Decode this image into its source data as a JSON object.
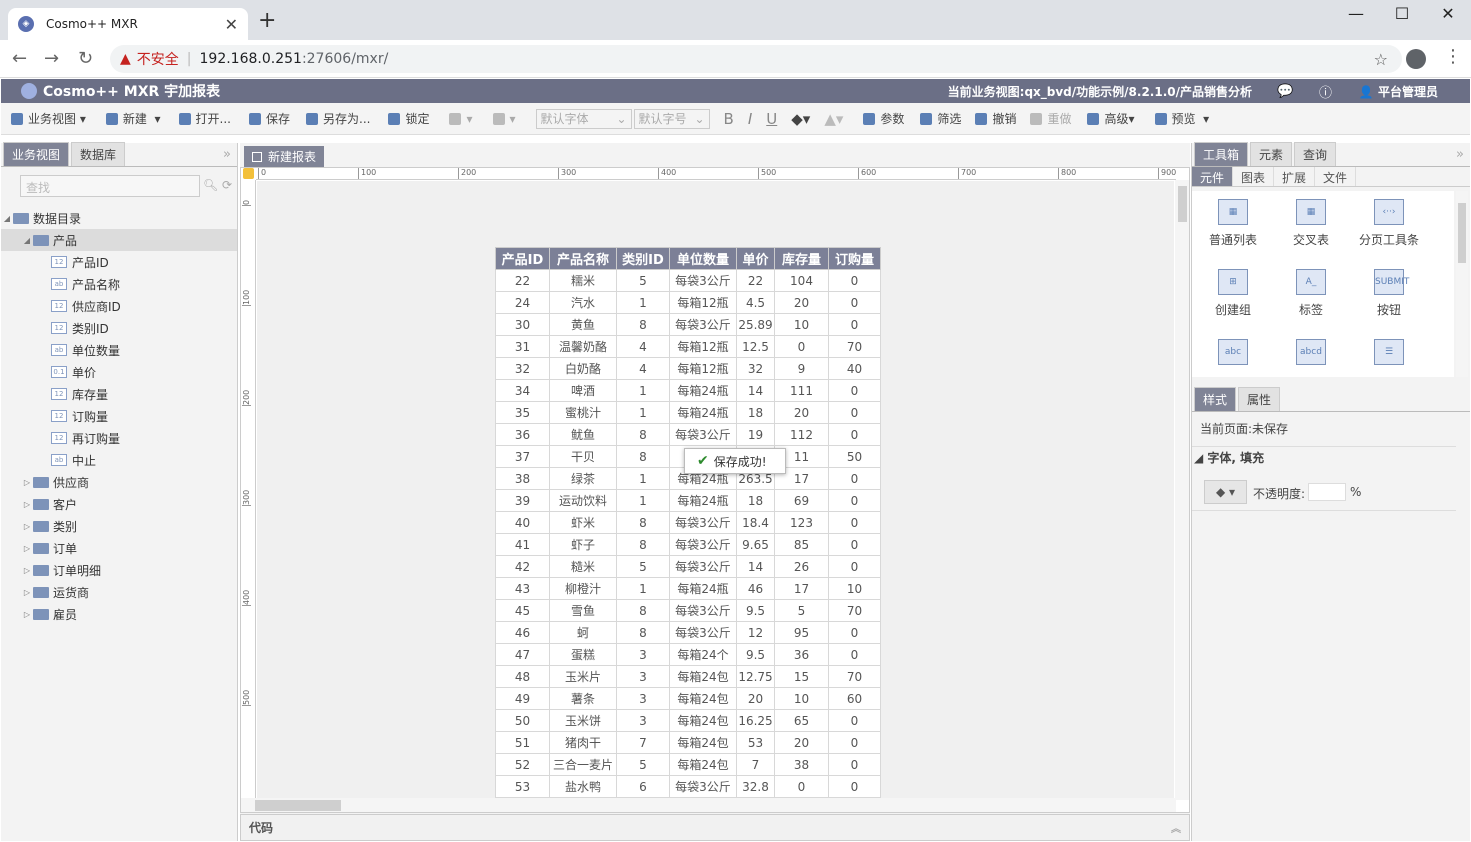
{
  "browser": {
    "tab_title": "Cosmo++ MXR",
    "insecure_label": "不安全",
    "url_host": "192.168.0.251",
    "url_rest": ":27606/mxr/"
  },
  "app": {
    "name": "Cosmo++ MXR 宇加报表",
    "business_view": "当前业务视图:qx_bvd/功能示例/8.2.1.0/产品销售分析",
    "user": "平台管理员"
  },
  "toolbar": {
    "business_view": "业务视图",
    "new": "新建",
    "open": "打开...",
    "save": "保存",
    "save_as": "另存为...",
    "lock": "锁定",
    "font_default": "默认字体",
    "size_default": "默认字号",
    "bold": "B",
    "italic": "I",
    "underline": "U",
    "params": "参数",
    "filter": "筛选",
    "undo": "撤销",
    "redo": "重做",
    "advanced": "高级",
    "preview": "预览"
  },
  "left_panel": {
    "tabs": [
      "业务视图",
      "数据库"
    ],
    "search_placeholder": "查找",
    "tree": {
      "root": "数据目录",
      "expanded": "产品",
      "fields": [
        {
          "type": "12",
          "label": "产品ID"
        },
        {
          "type": "ab",
          "label": "产品名称"
        },
        {
          "type": "12",
          "label": "供应商ID"
        },
        {
          "type": "12",
          "label": "类别ID"
        },
        {
          "type": "ab",
          "label": "单位数量"
        },
        {
          "type": "0.1",
          "label": "单价"
        },
        {
          "type": "12",
          "label": "库存量"
        },
        {
          "type": "12",
          "label": "订购量"
        },
        {
          "type": "12",
          "label": "再订购量"
        },
        {
          "type": "ab",
          "label": "中止"
        }
      ],
      "collapsed": [
        "供应商",
        "客户",
        "类别",
        "订单",
        "订单明细",
        "运货商",
        "雇员"
      ]
    }
  },
  "editor": {
    "doc_tab": "新建报表",
    "ruler_h": [
      "0",
      "100",
      "200",
      "300",
      "400",
      "500",
      "600",
      "700",
      "800",
      "900"
    ],
    "ruler_v": [
      "0",
      "100",
      "200",
      "300",
      "400",
      "500"
    ],
    "columns": [
      "产品ID",
      "产品名称",
      "类别ID",
      "单位数量",
      "单价",
      "库存量",
      "订购量"
    ],
    "rows": [
      [
        "22",
        "糯米",
        "5",
        "每袋3公斤",
        "22",
        "104",
        "0"
      ],
      [
        "24",
        "汽水",
        "1",
        "每箱12瓶",
        "4.5",
        "20",
        "0"
      ],
      [
        "30",
        "黄鱼",
        "8",
        "每袋3公斤",
        "25.89",
        "10",
        "0"
      ],
      [
        "31",
        "温馨奶酪",
        "4",
        "每箱12瓶",
        "12.5",
        "0",
        "70"
      ],
      [
        "32",
        "白奶酪",
        "4",
        "每箱12瓶",
        "32",
        "9",
        "40"
      ],
      [
        "34",
        "啤酒",
        "1",
        "每箱24瓶",
        "14",
        "111",
        "0"
      ],
      [
        "35",
        "蜜桃汁",
        "1",
        "每箱24瓶",
        "18",
        "20",
        "0"
      ],
      [
        "36",
        "鱿鱼",
        "8",
        "每袋3公斤",
        "19",
        "112",
        "0"
      ],
      [
        "37",
        "干贝",
        "8",
        "每",
        "",
        "11",
        "50"
      ],
      [
        "38",
        "绿茶",
        "1",
        "每箱24瓶",
        "263.5",
        "17",
        "0"
      ],
      [
        "39",
        "运动饮料",
        "1",
        "每箱24瓶",
        "18",
        "69",
        "0"
      ],
      [
        "40",
        "虾米",
        "8",
        "每袋3公斤",
        "18.4",
        "123",
        "0"
      ],
      [
        "41",
        "虾子",
        "8",
        "每袋3公斤",
        "9.65",
        "85",
        "0"
      ],
      [
        "42",
        "糙米",
        "5",
        "每袋3公斤",
        "14",
        "26",
        "0"
      ],
      [
        "43",
        "柳橙汁",
        "1",
        "每箱24瓶",
        "46",
        "17",
        "10"
      ],
      [
        "45",
        "雪鱼",
        "8",
        "每袋3公斤",
        "9.5",
        "5",
        "70"
      ],
      [
        "46",
        "蚵",
        "8",
        "每袋3公斤",
        "12",
        "95",
        "0"
      ],
      [
        "47",
        "蛋糕",
        "3",
        "每箱24个",
        "9.5",
        "36",
        "0"
      ],
      [
        "48",
        "玉米片",
        "3",
        "每箱24包",
        "12.75",
        "15",
        "70"
      ],
      [
        "49",
        "薯条",
        "3",
        "每箱24包",
        "20",
        "10",
        "60"
      ],
      [
        "50",
        "玉米饼",
        "3",
        "每箱24包",
        "16.25",
        "65",
        "0"
      ],
      [
        "51",
        "猪肉干",
        "7",
        "每箱24包",
        "53",
        "20",
        "0"
      ],
      [
        "52",
        "三合一麦片",
        "5",
        "每箱24包",
        "7",
        "38",
        "0"
      ],
      [
        "53",
        "盐水鸭",
        "6",
        "每袋3公斤",
        "32.8",
        "0",
        "0"
      ]
    ],
    "toast": "保存成功!",
    "code_label": "代码"
  },
  "right_panel": {
    "tabs": [
      "工具箱",
      "元素",
      "查询"
    ],
    "subtabs": [
      "元件",
      "图表",
      "扩展",
      "文件"
    ],
    "tools": [
      {
        "label": "普通列表",
        "icon": "table-icon"
      },
      {
        "label": "交叉表",
        "icon": "crosstab-icon"
      },
      {
        "label": "分页工具条",
        "icon": "pager-icon"
      },
      {
        "label": "创建组",
        "icon": "group-icon"
      },
      {
        "label": "标签",
        "icon": "label-icon"
      },
      {
        "label": "按钮",
        "icon": "button-icon"
      }
    ],
    "prop_tabs": [
      "样式",
      "属性"
    ],
    "current_page": "当前页面:未保存",
    "section": "字体, 填充",
    "opacity_label": "不透明度:",
    "opacity_unit": "%"
  },
  "colors": {
    "header_bg": "#6b6f86",
    "active_tab": "#808496",
    "grid_header": "#7c8097"
  }
}
